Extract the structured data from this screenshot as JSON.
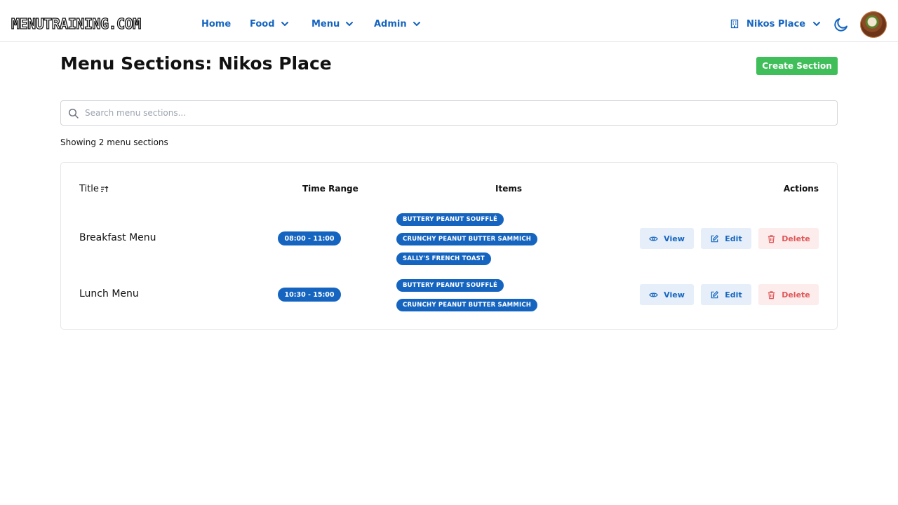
{
  "nav": {
    "logo": "MENUTRAINING.COM",
    "items": [
      {
        "label": "Home"
      },
      {
        "label": "Food"
      },
      {
        "label": "Menu"
      },
      {
        "label": "Admin"
      }
    ],
    "restaurant": "Nikos Place"
  },
  "page": {
    "title": "Menu Sections: Nikos Place",
    "create_label": "Create Section"
  },
  "search": {
    "placeholder": "Search menu sections...",
    "value": ""
  },
  "count_text": "Showing 2 menu sections",
  "table": {
    "headers": {
      "title": "Title",
      "time": "Time Range",
      "items": "Items",
      "actions": "Actions"
    },
    "rows": [
      {
        "title": "Breakfast Menu",
        "time": "08:00 - 11:00",
        "items": [
          "BUTTERY PEANUT SOUFFLÉ",
          "CRUNCHY PEANUT BUTTER SAMMICH",
          "SALLY'S FRENCH TOAST"
        ]
      },
      {
        "title": "Lunch Menu",
        "time": "10:30 - 15:00",
        "items": [
          "BUTTERY PEANUT SOUFFLÉ",
          "CRUNCHY PEANUT BUTTER SAMMICH"
        ]
      }
    ],
    "actions": {
      "view": "View",
      "edit": "Edit",
      "delete": "Delete"
    }
  },
  "colors": {
    "primary": "#1565c0",
    "success": "#3fbe5a",
    "danger": "#e05656",
    "soft_blue": "#e6eff9",
    "soft_red": "#fdecec"
  }
}
